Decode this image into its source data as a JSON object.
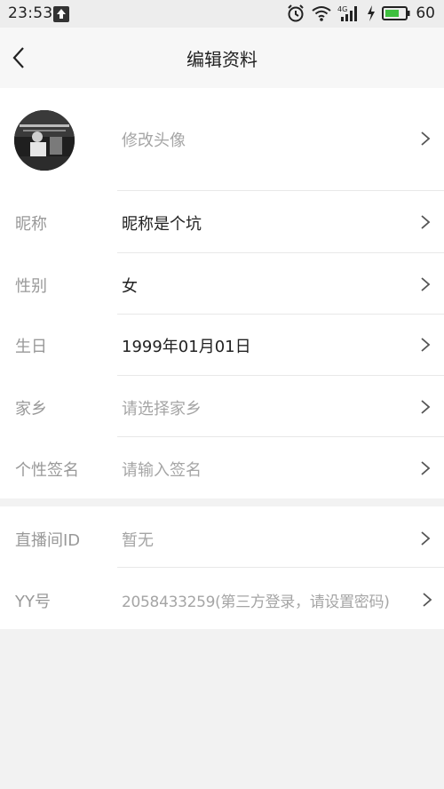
{
  "status_bar": {
    "time": "23:53",
    "battery_percent": "60",
    "icons": [
      "upload-icon",
      "alarm-icon",
      "wifi-icon",
      "signal-4g-icon",
      "charging-icon",
      "battery-icon"
    ]
  },
  "header": {
    "title": "编辑资料",
    "back_icon": "chevron-left-icon"
  },
  "profile": {
    "avatar_label": "修改头像",
    "rows": [
      {
        "label": "昵称",
        "value": "昵称是个坑",
        "placeholder": false
      },
      {
        "label": "性别",
        "value": "女",
        "placeholder": false
      },
      {
        "label": "生日",
        "value": "1999年01月01日",
        "placeholder": false
      },
      {
        "label": "家乡",
        "value": "请选择家乡",
        "placeholder": true
      },
      {
        "label": "个性签名",
        "value": "请输入签名",
        "placeholder": true
      }
    ]
  },
  "account": {
    "rows": [
      {
        "label": "直播间ID",
        "value": "暂无"
      },
      {
        "label": "YY号",
        "value": "2058433259(第三方登录，请设置密码)"
      }
    ]
  },
  "colors": {
    "page_background": "#f2f2f2",
    "row_background": "#ffffff",
    "label": "#999999",
    "value": "#222222",
    "placeholder": "#a5a5a5",
    "battery_green": "#3fbf3f"
  }
}
